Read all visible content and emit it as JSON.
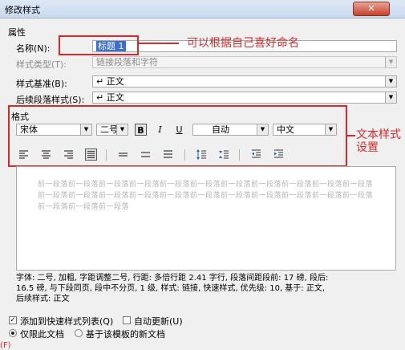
{
  "window": {
    "title": "修改样式",
    "close_label": "✕"
  },
  "properties": {
    "group_label": "属性",
    "name_label": "名称(N):",
    "name_value": "标题 1",
    "type_label": "样式类型(T):",
    "type_value": "链接段落和字符",
    "base_label": "样式基准(B):",
    "base_value": "↵ 正文",
    "next_label": "后续段落样式(S):",
    "next_value": "↵ 正文"
  },
  "annotations": {
    "name_note": "可以根据自己喜好命名",
    "format_note_line1": "文本样式",
    "format_note_line2": "设置"
  },
  "format": {
    "group_label": "格式",
    "font": "宋体",
    "size": "二号",
    "bold": "B",
    "italic": "I",
    "underline": "U",
    "color": "自动",
    "language": "中文"
  },
  "preview": {
    "line1": "前一段落前一段落前一段落前一段落前一段落前一段落前一段落前一段落前一段落前一段落前一段落",
    "line2": "前一段落前一段落前一段落前一段落前一段落前一段落前一段落前一段落前一段落前一段落前一段落",
    "line3": "前一段落前一段落前一段落"
  },
  "description": {
    "line1": "字体: 二号, 加粗, 字距调整二号, 行距: 多倍行距 2.41 字行, 段落间距段前: 17 磅, 段后:",
    "line2": "16.5 磅, 与下段同页, 段中不分页, 1 级, 样式: 链接, 快速样式, 优先级: 10, 基于: 正文,",
    "line3": "后续样式: 正文"
  },
  "options": {
    "add_quick_label": "添加到快速样式列表(Q)",
    "auto_update_label": "自动更新(U)",
    "only_doc_label": "仅限此文档",
    "new_docs_label": "基于该模板的新文档"
  },
  "footer": {
    "cut_text": "(F)"
  }
}
